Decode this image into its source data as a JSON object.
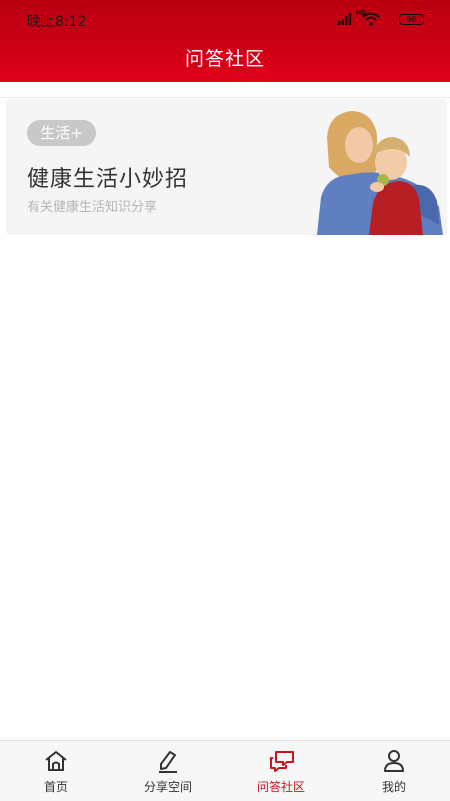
{
  "status_bar": {
    "time": "晚上8:12",
    "network": "HD",
    "battery": "96"
  },
  "header": {
    "title": "问答社区"
  },
  "card": {
    "tag": "生活+",
    "title": "健康生活小妙招",
    "subtitle": "有关健康生活知识分享",
    "image_icon": "mother-and-child-photo"
  },
  "tabs": [
    {
      "label": "首页",
      "icon": "home-icon",
      "active": false
    },
    {
      "label": "分享空间",
      "icon": "pen-icon",
      "active": false
    },
    {
      "label": "问答社区",
      "icon": "chat-icon",
      "active": true
    },
    {
      "label": "我的",
      "icon": "person-icon",
      "active": false
    }
  ],
  "colors": {
    "brand_red": "#d40f1d",
    "header_top": "#b70010",
    "header_bottom": "#e0001a"
  }
}
